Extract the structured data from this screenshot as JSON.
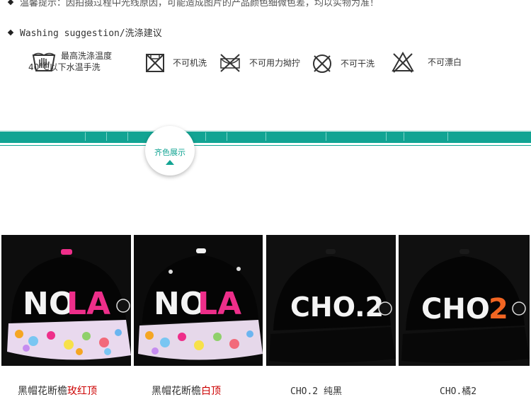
{
  "notice": {
    "text": "温馨提示：因拍摄过程中光线原因，可能造成图片的产品颜色细微色差，均以实物为准！"
  },
  "washing": {
    "title": "Washing suggestion/洗涤建议"
  },
  "care_items": [
    {
      "icon": "hand-wash-icon",
      "line1": "最高洗涤温度",
      "line2": "40°C以下水温手洗",
      "tub_label": "40°"
    },
    {
      "icon": "no-machine-wash-icon",
      "text": "不可机洗"
    },
    {
      "icon": "no-wring-icon",
      "text": "不可用力拗拧"
    },
    {
      "icon": "no-dry-clean-icon",
      "text": "不可干洗"
    },
    {
      "icon": "no-bleach-icon",
      "text": "不可漂白"
    }
  ],
  "section": {
    "badge": "齐色展示"
  },
  "products": [
    {
      "name": "黑帽花断檐",
      "variant": "玫红顶",
      "variant_color": "#cc0000",
      "cap_text": "NOLA",
      "brim": "floral"
    },
    {
      "name": "黑帽花断檐",
      "variant": "白顶",
      "variant_color": "#cc0000",
      "cap_text": "NOLA",
      "brim": "floral"
    },
    {
      "name": "CHO.2 纯黑",
      "cap_text": "CHO.2",
      "brim": "black"
    },
    {
      "name": "CHO.橘2",
      "cap_text": "CHO.2",
      "brim": "black"
    }
  ],
  "colors": {
    "teal": "#12a493",
    "pink": "#ee2e8a",
    "orange": "#f26522"
  }
}
